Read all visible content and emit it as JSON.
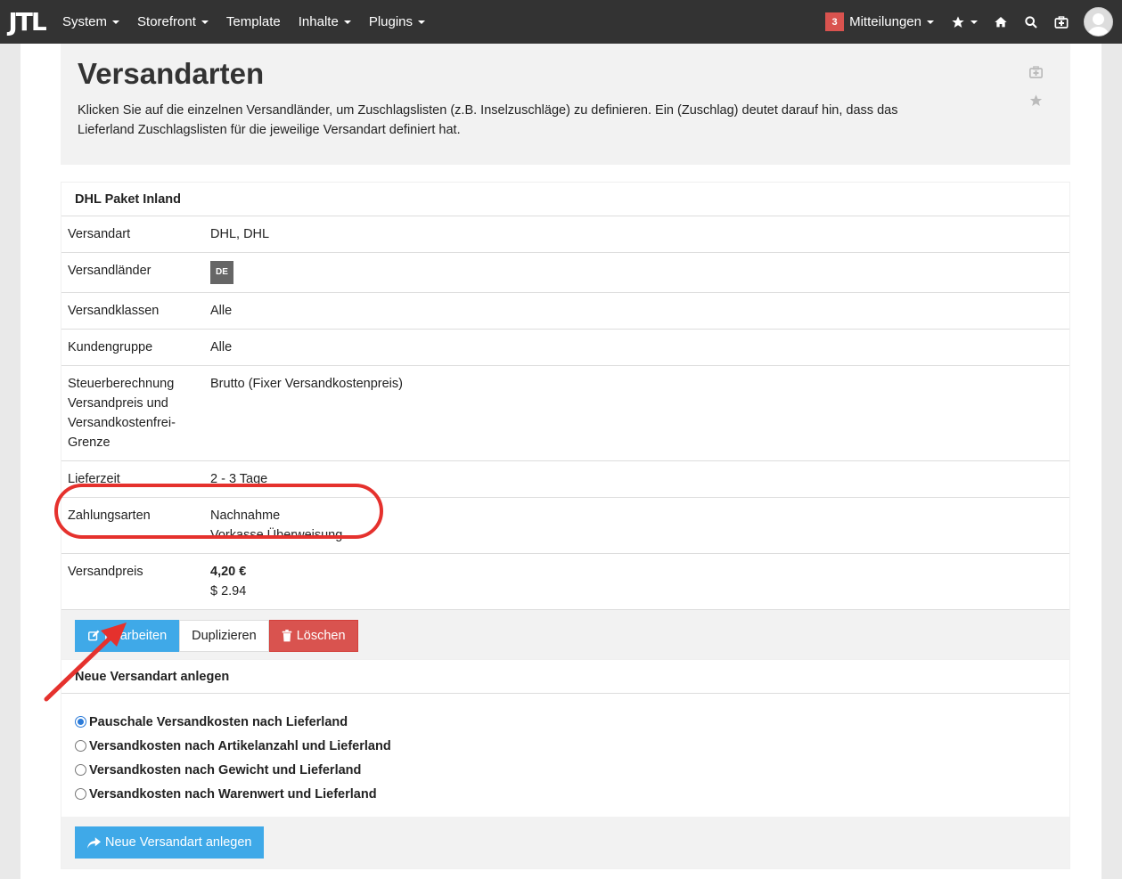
{
  "navbar": {
    "logo": "JTL",
    "items": [
      {
        "label": "System",
        "dropdown": true
      },
      {
        "label": "Storefront",
        "dropdown": true
      },
      {
        "label": "Template",
        "dropdown": false
      },
      {
        "label": "Inhalte",
        "dropdown": true
      },
      {
        "label": "Plugins",
        "dropdown": true
      }
    ],
    "notifications_count": "3",
    "notifications_label": "Mitteilungen",
    "icons": [
      "star-icon",
      "home-icon",
      "search-icon",
      "help-icon",
      "avatar"
    ]
  },
  "header": {
    "title": "Versandarten",
    "description": "Klicken Sie auf die einzelnen Versandländer, um Zuschlagslisten (z.B. Inselzuschläge) zu definieren. Ein (Zuschlag) deutet darauf hin, dass das Lieferland Zuschlagslisten für die jeweilige Versandart definiert hat."
  },
  "shipping_method": {
    "title": "DHL Paket Inland",
    "rows": {
      "versandart": {
        "label": "Versandart",
        "value": "DHL, DHL"
      },
      "versandlaender": {
        "label": "Versandländer",
        "value": "DE"
      },
      "versandklassen": {
        "label": "Versandklassen",
        "value": "Alle"
      },
      "kundengruppe": {
        "label": "Kundengruppe",
        "value": "Alle"
      },
      "steuer": {
        "label": "Steuerberechnung Versandpreis und Versandkostenfrei-Grenze",
        "value": "Brutto (Fixer Versandkostenpreis)"
      },
      "lieferzeit": {
        "label": "Lieferzeit",
        "value": "2 - 3 Tage"
      },
      "zahlungsarten": {
        "label": "Zahlungsarten",
        "value_1": "Nachnahme",
        "value_2": "Vorkasse Überweisung"
      },
      "versandpreis": {
        "label": "Versandpreis",
        "value_1": "4,20 €",
        "value_2": "$ 2.94"
      }
    },
    "buttons": {
      "edit": "Bearbeiten",
      "duplicate": "Duplizieren",
      "delete": "Löschen"
    }
  },
  "new_method": {
    "title": "Neue Versandart anlegen",
    "options": [
      {
        "label": "Pauschale Versandkosten nach Lieferland",
        "checked": true
      },
      {
        "label": "Versandkosten nach Artikelanzahl und Lieferland",
        "checked": false
      },
      {
        "label": "Versandkosten nach Gewicht und Lieferland",
        "checked": false
      },
      {
        "label": "Versandkosten nach Warenwert und Lieferland",
        "checked": false
      }
    ],
    "submit": "Neue Versandart anlegen"
  },
  "colors": {
    "navbar": "#333333",
    "primary": "#3fa9e8",
    "danger": "#d9534f",
    "annotation": "#e5312d"
  }
}
